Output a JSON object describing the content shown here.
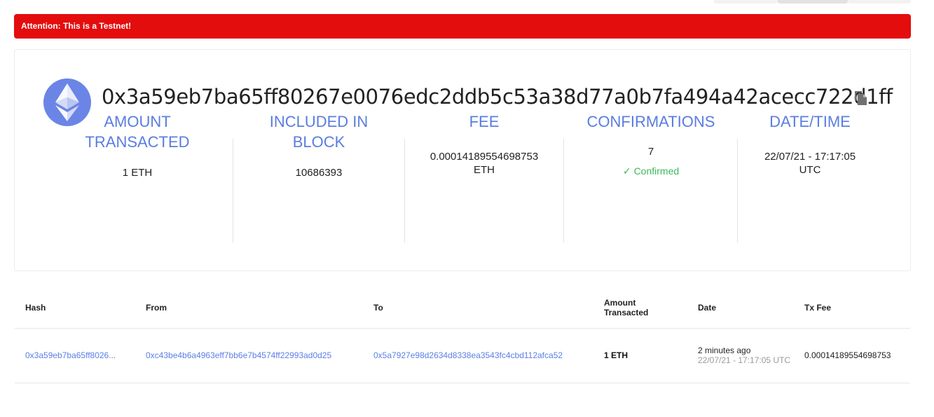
{
  "alert": {
    "text": "Attention: This is a Testnet!"
  },
  "transaction": {
    "hash": "0x3a59eb7ba65ff80267e0076edc2ddb5c53a38d77a0b7fa494a42acecc722d1ff"
  },
  "stats": [
    {
      "label": "AMOUNT TRANSACTED",
      "value": "1 ETH"
    },
    {
      "label": "INCLUDED IN BLOCK",
      "value": "10686393"
    },
    {
      "label": "FEE",
      "value": "0.00014189554698753 ETH"
    },
    {
      "label": "CONFIRMATIONS",
      "value": "7",
      "status": "Confirmed"
    },
    {
      "label": "DATE/TIME",
      "value": "22/07/21 - 17:17:05 UTC"
    }
  ],
  "table": {
    "headers": [
      "Hash",
      "From",
      "To",
      "Amount Transacted",
      "Date",
      "Tx Fee"
    ],
    "rows": [
      {
        "hash": "0x3a59eb7ba65ff8026...",
        "from": "0xc43be4b6a4963eff7bb6e7b4574ff22993ad0d25",
        "to": "0x5a7927e98d2634d8338ea3543fc4cbd112afca52",
        "amount": "1 ETH",
        "date_relative": "2 minutes ago",
        "date_absolute": "22/07/21 - 17:17:05 UTC",
        "fee": "0.00014189554698753"
      }
    ]
  },
  "colors": {
    "alert": "#e40d0d",
    "accent": "#5a7de0",
    "success": "#3cb95b",
    "eth_logo_bg": "#6b85e6"
  },
  "icons": {
    "logo": "ethereum-icon",
    "copy": "copy-icon",
    "check": "check-icon"
  }
}
